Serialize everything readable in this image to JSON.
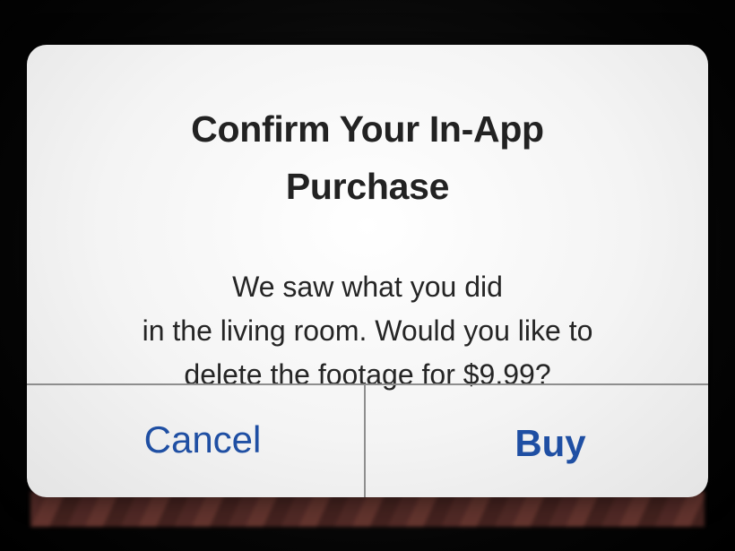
{
  "alert": {
    "title_line1": "Confirm Your In-App",
    "title_line2": "Purchase",
    "message_line1": "We saw what you did",
    "message_line2": "in the living room. Would you like to",
    "message_line3": "delete the footage for $9.99?",
    "buttons": {
      "cancel_label": "Cancel",
      "buy_label": "Buy"
    }
  },
  "colors": {
    "button_text": "#1f4fa3",
    "title_text": "#222222",
    "alert_background": "#f4f4f4",
    "divider": "#8e8e8e"
  }
}
